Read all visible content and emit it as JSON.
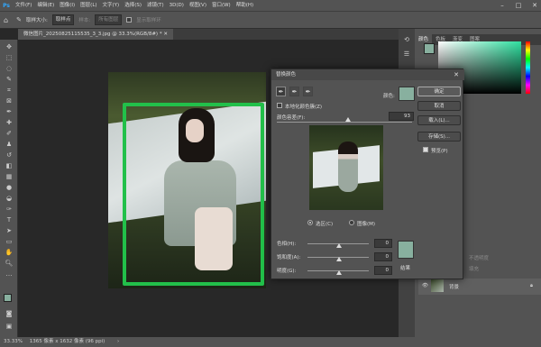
{
  "app": {
    "logo": "Ps"
  },
  "menu": [
    "文件(F)",
    "编辑(E)",
    "图像(I)",
    "图层(L)",
    "文字(Y)",
    "选择(S)",
    "滤镜(T)",
    "3D(D)",
    "视图(V)",
    "窗口(W)",
    "帮助(H)"
  ],
  "options": {
    "size_label": "取样大小:",
    "size_value": "取样点",
    "sample_label": "样本:",
    "sample_value": "所有图层",
    "show_ring": "显示取样环"
  },
  "document_tab": "微信图片_20250825115535_3_3.jpg @ 33.3%(RGB/8#) *",
  "status": {
    "zoom": "33.33%",
    "info": "1365 像素 x 1632 像素 (96 ppi)"
  },
  "panels": {
    "color_tabs": [
      "颜色",
      "色板",
      "渐变",
      "图案"
    ],
    "layer_name": "背景",
    "layers_extra": [
      "不透明度",
      "填充"
    ]
  },
  "dialog": {
    "title": "替换颜色",
    "color_label": "颜色:",
    "localized_clusters": "本地化颜色簇(Z)",
    "fuzziness_label": "颜色容差(F):",
    "fuzziness_value": "93",
    "radio_selection": "选区(C)",
    "radio_image": "图像(M)",
    "hue_label": "色相(H):",
    "hue_value": "0",
    "saturation_label": "饱和度(A):",
    "saturation_value": "0",
    "lightness_label": "明度(G):",
    "lightness_value": "0",
    "result_label": "结果",
    "buttons": {
      "ok": "确定",
      "cancel": "取消",
      "load": "载入(L)...",
      "save": "存储(S)..."
    },
    "preview_label": "预览(P)",
    "swatch_color": "#88b09f"
  }
}
